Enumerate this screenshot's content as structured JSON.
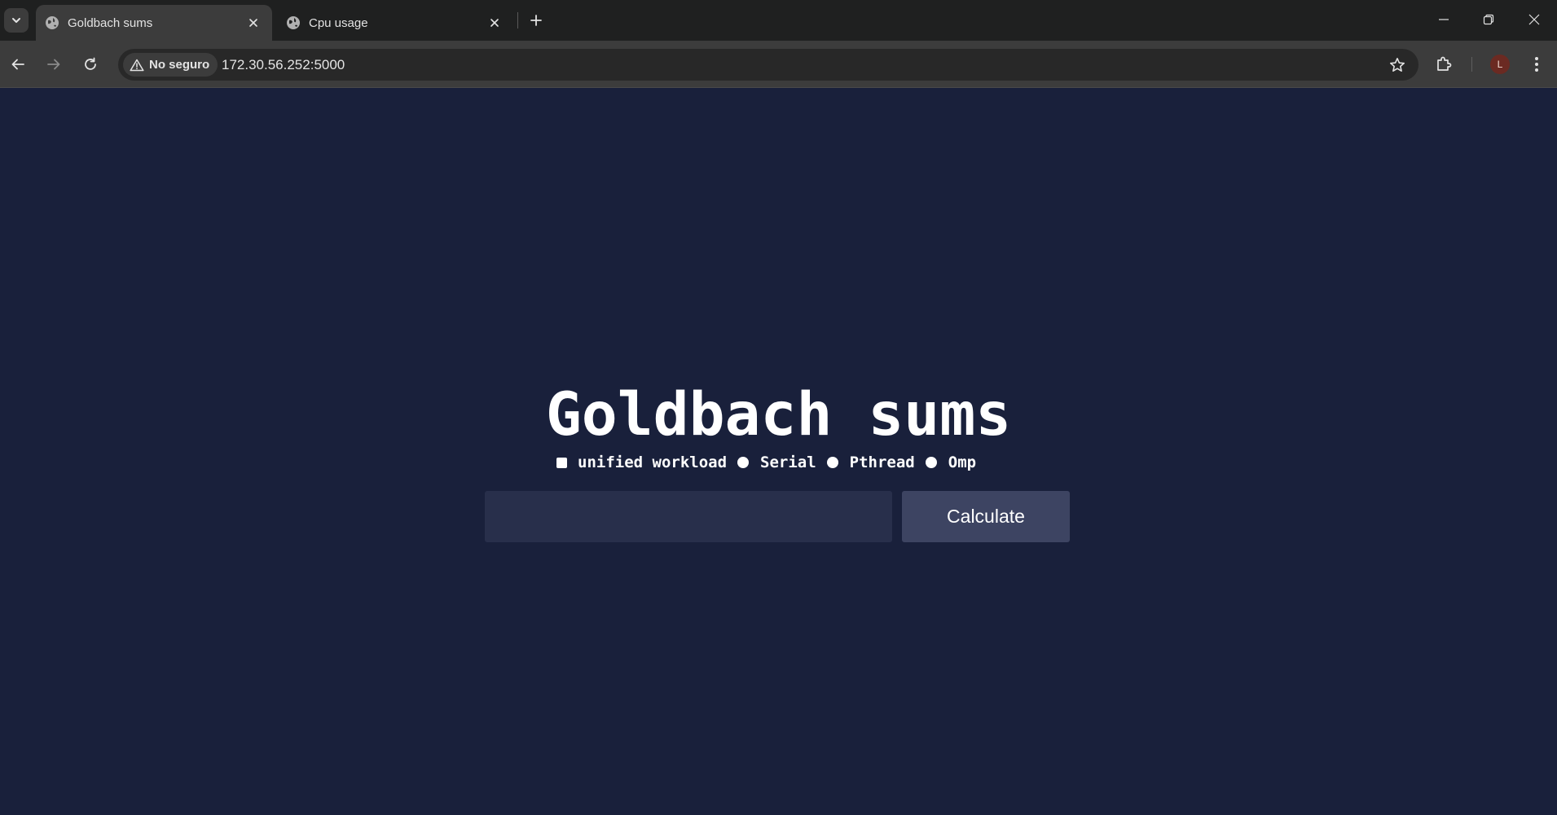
{
  "browser": {
    "tabs": [
      {
        "title": "Goldbach sums",
        "active": true,
        "icon": "globe-icon"
      },
      {
        "title": "Cpu usage",
        "active": false,
        "icon": "globe-icon"
      }
    ],
    "security_label": "No seguro",
    "url": "172.30.56.252:5000",
    "profile_initial": "L"
  },
  "page": {
    "title": "Goldbach sums",
    "options": [
      {
        "type": "checkbox",
        "label": "unified workload",
        "checked": false
      },
      {
        "type": "radio",
        "label": "Serial",
        "checked": false
      },
      {
        "type": "radio",
        "label": "Pthread",
        "checked": false
      },
      {
        "type": "radio",
        "label": "Omp",
        "checked": false
      }
    ],
    "input_value": "",
    "calculate_label": "Calculate",
    "colors": {
      "background": "#19203b",
      "input_background": "#282f4b",
      "button_background": "#3d4462",
      "text": "#ffffff"
    }
  }
}
